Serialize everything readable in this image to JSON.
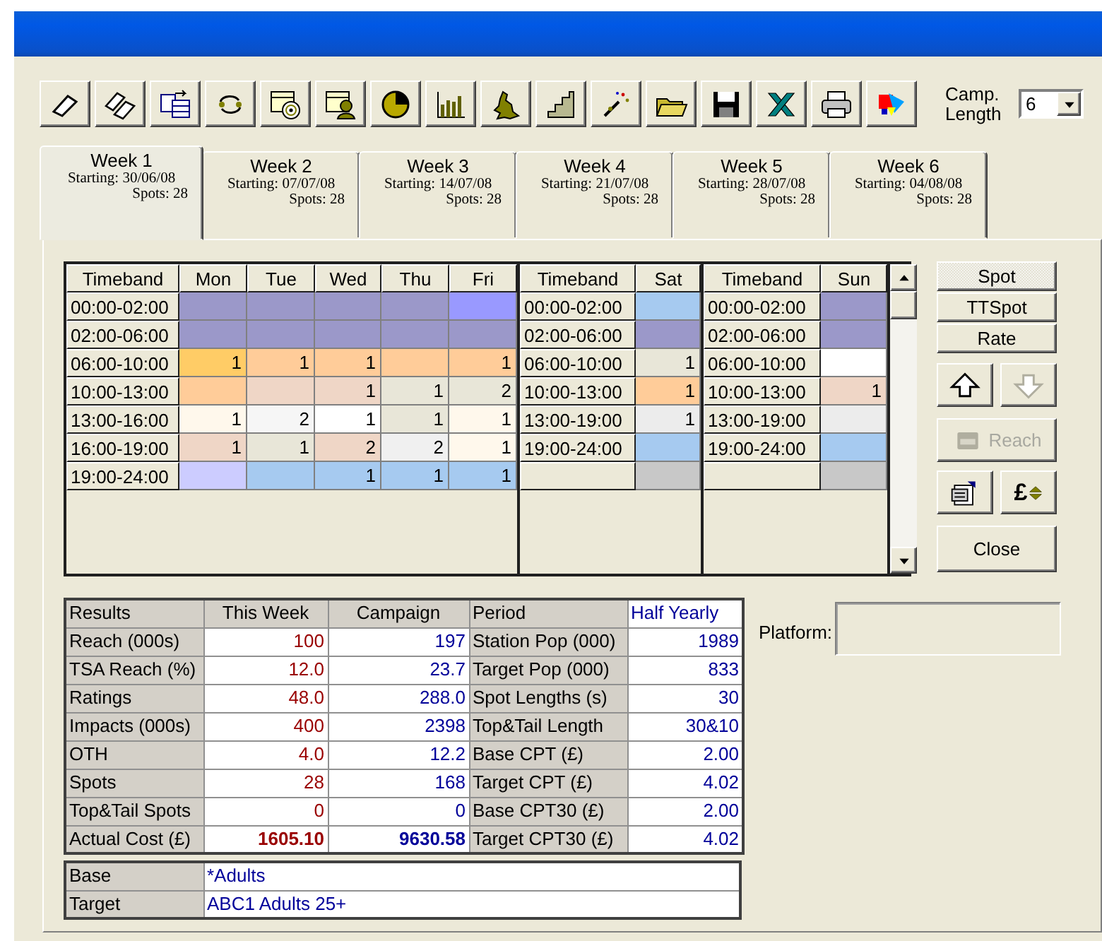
{
  "camp_length": {
    "label": "Camp. Length",
    "value": "6"
  },
  "tabs": [
    {
      "label": "Week 1",
      "starting": "Starting: 30/06/08",
      "spots": "Spots: 28",
      "selected": true
    },
    {
      "label": "Week 2",
      "starting": "Starting: 07/07/08",
      "spots": "Spots: 28",
      "selected": false
    },
    {
      "label": "Week 3",
      "starting": "Starting: 14/07/08",
      "spots": "Spots: 28",
      "selected": false
    },
    {
      "label": "Week 4",
      "starting": "Starting: 21/07/08",
      "spots": "Spots: 28",
      "selected": false
    },
    {
      "label": "Week 5",
      "starting": "Starting: 28/07/08",
      "spots": "Spots: 28",
      "selected": false
    },
    {
      "label": "Week 6",
      "starting": "Starting: 04/08/08",
      "spots": "Spots: 28",
      "selected": false
    }
  ],
  "grid": {
    "sections": [
      {
        "columns": [
          "Timeband",
          "Mon",
          "Tue",
          "Wed",
          "Thu",
          "Fri"
        ],
        "rows": [
          {
            "timeband": "00:00-02:00",
            "cells": [
              {
                "color": "#9b98c9"
              },
              {
                "color": "#9b98c9"
              },
              {
                "color": "#9b98c9"
              },
              {
                "color": "#9b98c9"
              },
              {
                "color": "#9999ff"
              }
            ]
          },
          {
            "timeband": "02:00-06:00",
            "cells": [
              {
                "color": "#9b98c9"
              },
              {
                "color": "#9b98c9"
              },
              {
                "color": "#9b98c9"
              },
              {
                "color": "#9b98c9"
              },
              {
                "color": "#9b98c9"
              }
            ]
          },
          {
            "timeband": "06:00-10:00",
            "cells": [
              {
                "color": "#ffcc66",
                "value": "1"
              },
              {
                "color": "#ffcc99",
                "value": "1"
              },
              {
                "color": "#ffcc99",
                "value": "1"
              },
              {
                "color": "#ffcc99"
              },
              {
                "color": "#ffcc99",
                "value": "1"
              }
            ]
          },
          {
            "timeband": "10:00-13:00",
            "cells": [
              {
                "color": "#ffcc99"
              },
              {
                "color": "#efd6c6"
              },
              {
                "color": "#efd6c6",
                "value": "1"
              },
              {
                "color": "#e8e6d8",
                "value": "1"
              },
              {
                "color": "#e8e6d8",
                "value": "2"
              }
            ]
          },
          {
            "timeband": "13:00-16:00",
            "cells": [
              {
                "color": "#fff8ec",
                "value": "1"
              },
              {
                "color": "#f6f6f6",
                "value": "2"
              },
              {
                "color": "#ffffff",
                "value": "1"
              },
              {
                "color": "#e8e6d8",
                "value": "1"
              },
              {
                "color": "#fff8ec",
                "value": "1"
              }
            ]
          },
          {
            "timeband": "16:00-19:00",
            "cells": [
              {
                "color": "#efd6c6",
                "value": "1"
              },
              {
                "color": "#e8e6d8",
                "value": "1"
              },
              {
                "color": "#efd6c6",
                "value": "2"
              },
              {
                "color": "#f0f0f0",
                "value": "2"
              },
              {
                "color": "#fff8ec",
                "value": "1"
              }
            ]
          },
          {
            "timeband": "19:00-24:00",
            "cells": [
              {
                "color": "#ccccff"
              },
              {
                "color": "#a6caf0"
              },
              {
                "color": "#a6caf0",
                "value": "1"
              },
              {
                "color": "#a6caf0",
                "value": "1"
              },
              {
                "color": "#a6caf0",
                "value": "1"
              }
            ]
          }
        ]
      },
      {
        "columns": [
          "Timeband",
          "Sat"
        ],
        "rows": [
          {
            "timeband": "00:00-02:00",
            "cells": [
              {
                "color": "#a6caf0"
              }
            ]
          },
          {
            "timeband": "02:00-06:00",
            "cells": [
              {
                "color": "#9b98c9"
              }
            ]
          },
          {
            "timeband": "06:00-10:00",
            "cells": [
              {
                "color": "#e8e6d8",
                "value": "1"
              }
            ]
          },
          {
            "timeband": "10:00-13:00",
            "cells": [
              {
                "color": "#ffcc99",
                "value": "1"
              }
            ]
          },
          {
            "timeband": "13:00-19:00",
            "cells": [
              {
                "color": "#ececec",
                "value": "1"
              }
            ]
          },
          {
            "timeband": "19:00-24:00",
            "cells": [
              {
                "color": "#a6caf0"
              }
            ]
          },
          {
            "cells": [
              {
                "color": "#c8c8c8"
              }
            ]
          }
        ]
      },
      {
        "columns": [
          "Timeband",
          "Sun"
        ],
        "rows": [
          {
            "timeband": "00:00-02:00",
            "cells": [
              {
                "color": "#9b98c9"
              }
            ]
          },
          {
            "timeband": "02:00-06:00",
            "cells": [
              {
                "color": "#9b98c9"
              }
            ]
          },
          {
            "timeband": "06:00-10:00",
            "cells": [
              {
                "color": "#ffffff"
              }
            ]
          },
          {
            "timeband": "10:00-13:00",
            "cells": [
              {
                "color": "#efd6c6",
                "value": "1"
              }
            ]
          },
          {
            "timeband": "13:00-19:00",
            "cells": [
              {
                "color": "#ececec"
              }
            ]
          },
          {
            "timeband": "19:00-24:00",
            "cells": [
              {
                "color": "#a6caf0"
              }
            ]
          },
          {
            "cells": [
              {
                "color": "#c8c8c8"
              }
            ]
          }
        ]
      }
    ]
  },
  "mode_buttons": [
    {
      "label": "Spot",
      "selected": true
    },
    {
      "label": "TTSpot",
      "selected": false
    },
    {
      "label": "Rate",
      "selected": false
    }
  ],
  "move_buttons": [
    {
      "kind": "up",
      "disabled": false
    },
    {
      "kind": "down",
      "disabled": true
    }
  ],
  "reach_button": {
    "label": "Reach",
    "disabled": true
  },
  "currency_button": {
    "label": "£"
  },
  "close_button": {
    "label": "Close"
  },
  "results": {
    "header": [
      "Results",
      "This Week",
      "Campaign",
      "Period",
      "Half Yearly"
    ],
    "rows": [
      {
        "metric": "Reach (000s)",
        "this_week": "100",
        "campaign": "197",
        "parameter": "Station Pop (000)",
        "value": "1989",
        "total": false
      },
      {
        "metric": "TSA Reach (%)",
        "this_week": "12.0",
        "campaign": "23.7",
        "parameter": "Target Pop (000)",
        "value": "833",
        "total": false
      },
      {
        "metric": "Ratings",
        "this_week": "48.0",
        "campaign": "288.0",
        "parameter": "Spot Lengths (s)",
        "value": "30",
        "total": false
      },
      {
        "metric": "Impacts (000s)",
        "this_week": "400",
        "campaign": "2398",
        "parameter": "Top&Tail Length",
        "value": "30&10",
        "total": false
      },
      {
        "metric": "OTH",
        "this_week": "4.0",
        "campaign": "12.2",
        "parameter": "Base CPT (£)",
        "value": "2.00",
        "total": false
      },
      {
        "metric": "Spots",
        "this_week": "28",
        "campaign": "168",
        "parameter": "Target CPT (£)",
        "value": "4.02",
        "total": false
      },
      {
        "metric": "Top&Tail Spots",
        "this_week": "0",
        "campaign": "0",
        "parameter": "Base CPT30 (£)",
        "value": "2.00",
        "total": false
      },
      {
        "metric": "Actual Cost (£)",
        "this_week": "1605.10",
        "campaign": "9630.58",
        "parameter": "Target CPT30 (£)",
        "value": "4.02",
        "total": true
      }
    ]
  },
  "audience": [
    {
      "label": "Base",
      "value": "*Adults"
    },
    {
      "label": "Target",
      "value": "ABC1 Adults 25+"
    }
  ],
  "platform": {
    "label": "Platform:"
  }
}
